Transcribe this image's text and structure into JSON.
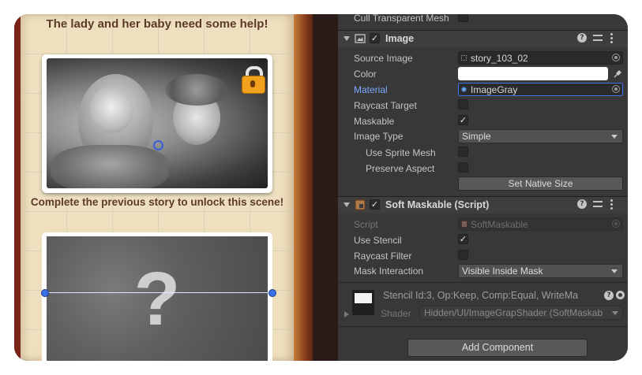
{
  "scene": {
    "title": "The lady and her baby need some help!",
    "caption": "Complete the previous story to unlock this scene!",
    "mystery_mark": "?",
    "lock_icon": "lock-icon"
  },
  "inspector": {
    "cull_row": {
      "label": "Cull Transparent Mesh"
    },
    "image": {
      "title": "Image",
      "enabled": true,
      "source_image": {
        "label": "Source Image",
        "value": "story_103_02"
      },
      "color": {
        "label": "Color",
        "value": "#ffffff"
      },
      "material": {
        "label": "Material",
        "value": "ImageGray"
      },
      "raycast_target": {
        "label": "Raycast Target",
        "checked": false
      },
      "maskable": {
        "label": "Maskable",
        "checked": true
      },
      "image_type": {
        "label": "Image Type",
        "value": "Simple"
      },
      "use_sprite_mesh": {
        "label": "Use Sprite Mesh",
        "checked": false
      },
      "preserve_aspect": {
        "label": "Preserve Aspect",
        "checked": false
      },
      "set_native_size": "Set Native Size"
    },
    "soft_maskable": {
      "title": "Soft Maskable (Script)",
      "enabled": true,
      "script": {
        "label": "Script",
        "value": "SoftMaskable"
      },
      "use_stencil": {
        "label": "Use Stencil",
        "checked": true
      },
      "raycast_filter": {
        "label": "Raycast Filter",
        "checked": false
      },
      "mask_interaction": {
        "label": "Mask Interaction",
        "value": "Visible Inside Mask"
      }
    },
    "material_preview": {
      "info": "Stencil Id:3, Op:Keep, Comp:Equal, WriteMa",
      "shader_label": "Shader",
      "shader_value": "Hidden/UI/ImageGrapShader (SoftMaskab"
    },
    "add_component": "Add Component",
    "check_glyph": "✓",
    "help_glyph": "?"
  }
}
